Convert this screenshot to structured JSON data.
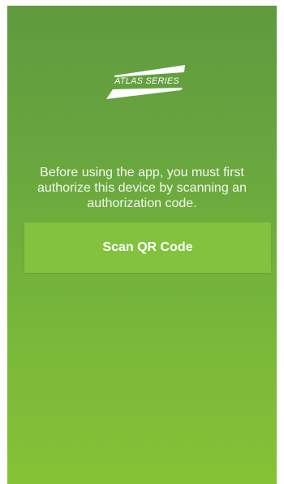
{
  "app": {
    "logo_text": "ATLAS SERIES"
  },
  "message": {
    "text": "Before using the app, you must first authorize this device by scanning an authorization code."
  },
  "scan_button": {
    "label": "Scan QR Code"
  },
  "colors": {
    "background_top": "#5f9a3e",
    "background_bottom": "#86c236",
    "button": "#82c23f",
    "text": "#ffffff"
  }
}
